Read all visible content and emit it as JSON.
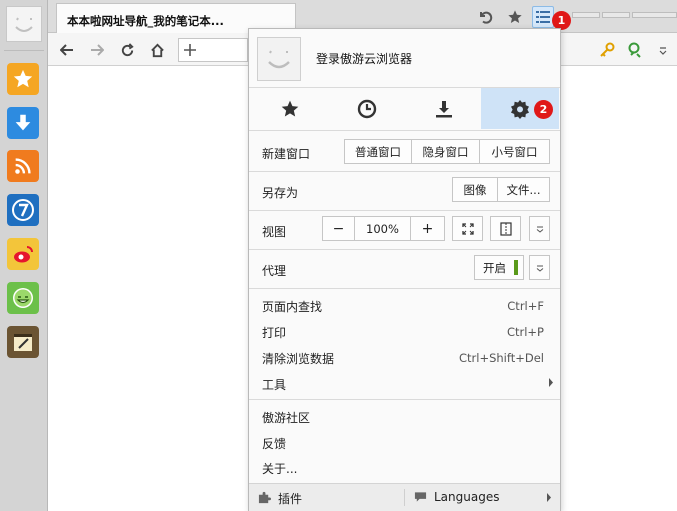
{
  "tab": {
    "title": "本本啦网址导航_我的笔记本..."
  },
  "badges": {
    "menu": "1",
    "settings": "2"
  },
  "menu": {
    "login_label": "登录傲游云浏览器",
    "new_window": {
      "label": "新建窗口",
      "normal": "普通窗口",
      "private": "隐身窗口",
      "mini": "小号窗口"
    },
    "save_as": {
      "label": "另存为",
      "image": "图像",
      "file": "文件..."
    },
    "view": {
      "label": "视图",
      "zoom_out": "−",
      "zoom": "100%",
      "zoom_in": "+"
    },
    "proxy": {
      "label": "代理",
      "state": "开启"
    },
    "items": [
      {
        "label": "页面内查找",
        "shortcut": "Ctrl+F"
      },
      {
        "label": "打印",
        "shortcut": "Ctrl+P"
      },
      {
        "label": "清除浏览数据",
        "shortcut": "Ctrl+Shift+Del"
      },
      {
        "label": "工具",
        "shortcut": ""
      }
    ],
    "community": "傲游社区",
    "feedback": "反馈",
    "about": "关于...",
    "footer": {
      "plugins": "插件",
      "languages": "Languages"
    }
  },
  "colors": {
    "accent": "#cfe3f7",
    "badge": "#e01818",
    "proxy_on": "#5a9a1a"
  }
}
